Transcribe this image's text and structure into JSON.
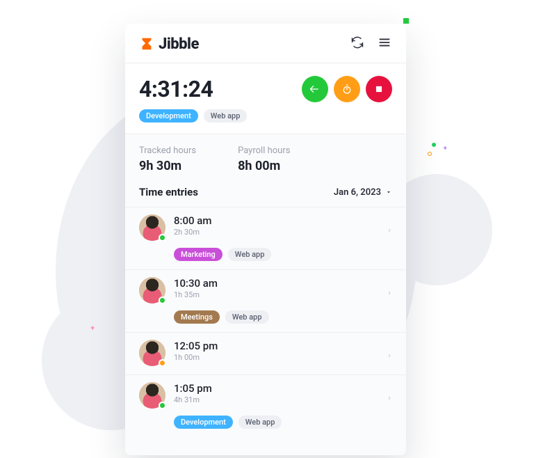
{
  "brand": {
    "name": "Jibble"
  },
  "timer": {
    "value": "4:31:24",
    "activity_tag": "Development",
    "project_tag": "Web app"
  },
  "summary": {
    "tracked_label": "Tracked hours",
    "tracked_value": "9h 30m",
    "payroll_label": "Payroll hours",
    "payroll_value": "8h 00m"
  },
  "entries": {
    "title": "Time entries",
    "date": "Jan 6, 2023",
    "items": [
      {
        "time": "8:00 am",
        "duration": "2h 30m",
        "activity": "Marketing",
        "activity_color": "purple",
        "project": "Web app",
        "status": "green"
      },
      {
        "time": "10:30 am",
        "duration": "1h 35m",
        "activity": "Meetings",
        "activity_color": "brown",
        "project": "Web app",
        "status": "green"
      },
      {
        "time": "12:05 pm",
        "duration": "1h 00m",
        "activity": "",
        "activity_color": "",
        "project": "",
        "status": "orange"
      },
      {
        "time": "1:05 pm",
        "duration": "4h 31m",
        "activity": "Development",
        "activity_color": "blue",
        "project": "Web app",
        "status": "green"
      }
    ]
  }
}
